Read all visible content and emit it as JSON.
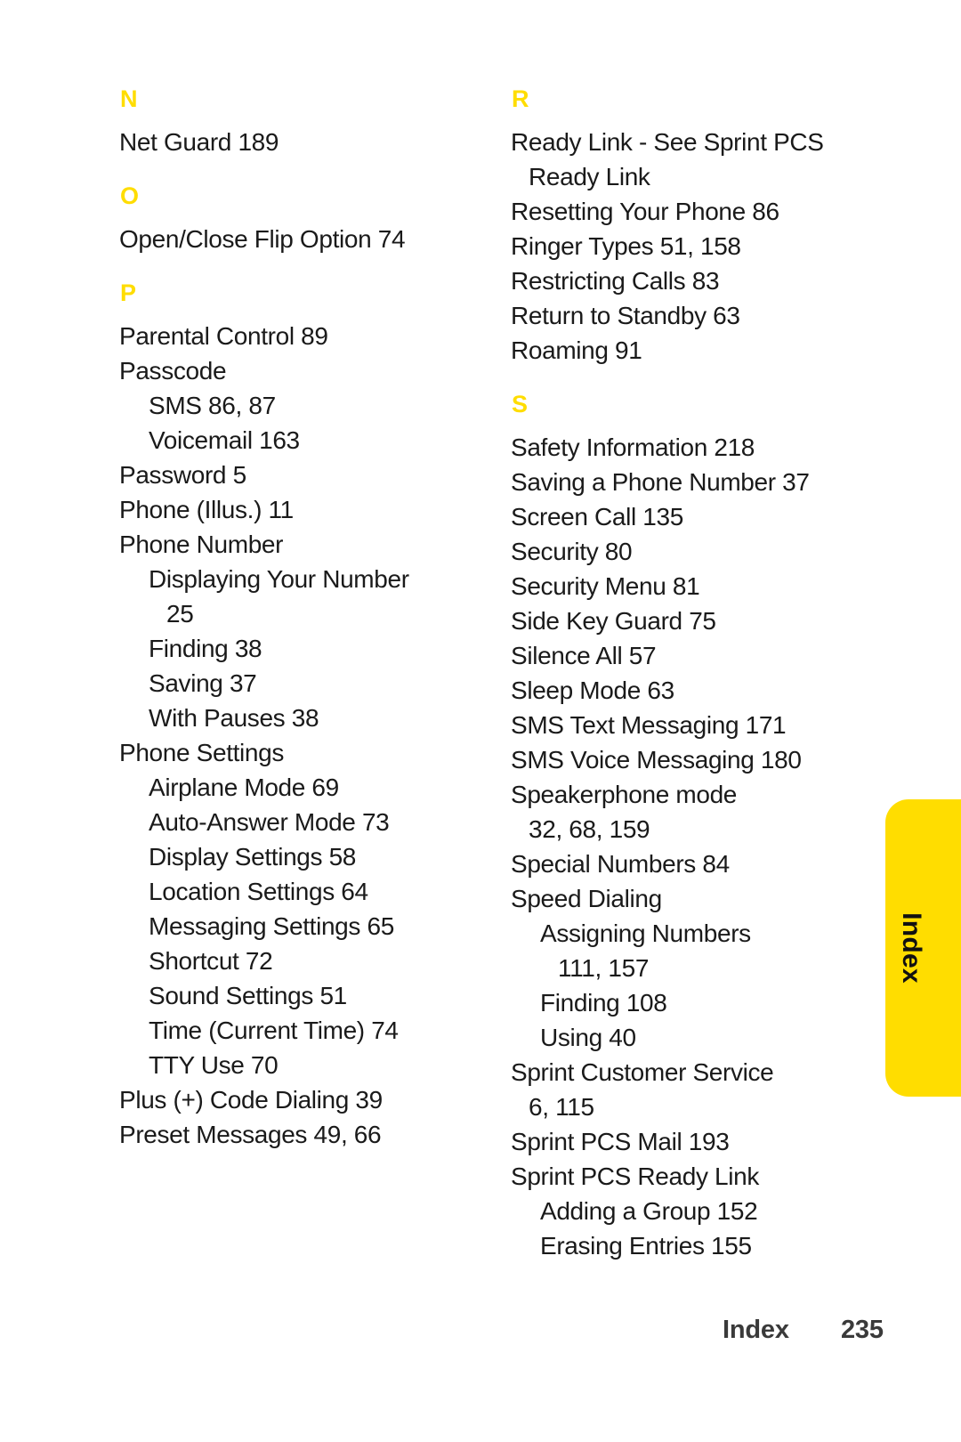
{
  "page": {
    "accent_color": "#FFDD00",
    "text_color": "#1a1a1a",
    "background_color": "#ffffff"
  },
  "side_tab": {
    "label": "Index"
  },
  "footer": {
    "section_label": "Index",
    "page_number": "235"
  },
  "left_column": {
    "sections": [
      {
        "letter": "N",
        "entries": [
          {
            "text": "Net Guard 189",
            "level": 1
          }
        ]
      },
      {
        "letter": "O",
        "entries": [
          {
            "text": "Open/Close Flip Option 74",
            "level": 1
          }
        ]
      },
      {
        "letter": "P",
        "entries": [
          {
            "text": "Parental Control 89",
            "level": 1
          },
          {
            "text": "Passcode",
            "level": 1
          },
          {
            "text": "SMS 86, 87",
            "level": 2
          },
          {
            "text": "Voicemail 163",
            "level": 2
          },
          {
            "text": "Password 5",
            "level": 1
          },
          {
            "text": "Phone (Illus.) 11",
            "level": 1
          },
          {
            "text": "Phone Number",
            "level": 1
          },
          {
            "text": "Displaying Your Number",
            "level": 2
          },
          {
            "text": "25",
            "level": "cont-2"
          },
          {
            "text": "Finding 38",
            "level": 2
          },
          {
            "text": "Saving 37",
            "level": 2
          },
          {
            "text": "With Pauses 38",
            "level": 2
          },
          {
            "text": "Phone Settings",
            "level": 1
          },
          {
            "text": "Airplane Mode 69",
            "level": 2
          },
          {
            "text": "Auto-Answer Mode 73",
            "level": 2
          },
          {
            "text": "Display Settings 58",
            "level": 2
          },
          {
            "text": "Location Settings 64",
            "level": 2
          },
          {
            "text": "Messaging Settings 65",
            "level": 2
          },
          {
            "text": "Shortcut 72",
            "level": 2
          },
          {
            "text": "Sound Settings 51",
            "level": 2
          },
          {
            "text": "Time (Current Time) 74",
            "level": 2
          },
          {
            "text": "TTY Use 70",
            "level": 2
          },
          {
            "text": "Plus (+) Code Dialing 39",
            "level": 1
          },
          {
            "text": "Preset Messages 49, 66",
            "level": 1
          }
        ]
      }
    ]
  },
  "right_column": {
    "sections": [
      {
        "letter": "R",
        "entries": [
          {
            "text": "Ready Link - See Sprint PCS",
            "level": 1
          },
          {
            "text": "Ready Link",
            "level": "cont-1"
          },
          {
            "text": "Resetting Your Phone 86",
            "level": 1
          },
          {
            "text": "Ringer Types 51, 158",
            "level": 1
          },
          {
            "text": "Restricting Calls 83",
            "level": 1
          },
          {
            "text": "Return to Standby 63",
            "level": 1
          },
          {
            "text": "Roaming 91",
            "level": 1
          }
        ]
      },
      {
        "letter": "S",
        "entries": [
          {
            "text": "Safety Information 218",
            "level": 1
          },
          {
            "text": "Saving a Phone Number 37",
            "level": 1
          },
          {
            "text": "Screen Call 135",
            "level": 1
          },
          {
            "text": "Security 80",
            "level": 1
          },
          {
            "text": "Security Menu 81",
            "level": 1
          },
          {
            "text": "Side Key Guard 75",
            "level": 1
          },
          {
            "text": "Silence All 57",
            "level": 1
          },
          {
            "text": "Sleep Mode 63",
            "level": 1
          },
          {
            "text": "SMS Text Messaging 171",
            "level": 1
          },
          {
            "text": "SMS Voice Messaging 180",
            "level": 1
          },
          {
            "text": "Speakerphone mode",
            "level": 1
          },
          {
            "text": "32, 68, 159",
            "level": "cont-1"
          },
          {
            "text": "Special Numbers 84",
            "level": 1
          },
          {
            "text": "Speed Dialing",
            "level": 1
          },
          {
            "text": "Assigning Numbers",
            "level": 2
          },
          {
            "text": "111, 157",
            "level": "cont-2"
          },
          {
            "text": "Finding 108",
            "level": 2
          },
          {
            "text": "Using 40",
            "level": 2
          },
          {
            "text": "Sprint Customer Service",
            "level": 1
          },
          {
            "text": "6, 115",
            "level": "cont-1"
          },
          {
            "text": "Sprint PCS Mail 193",
            "level": 1
          },
          {
            "text": "Sprint PCS Ready Link",
            "level": 1
          },
          {
            "text": "Adding a Group 152",
            "level": 2
          },
          {
            "text": "Erasing Entries 155",
            "level": 2
          }
        ]
      }
    ]
  }
}
